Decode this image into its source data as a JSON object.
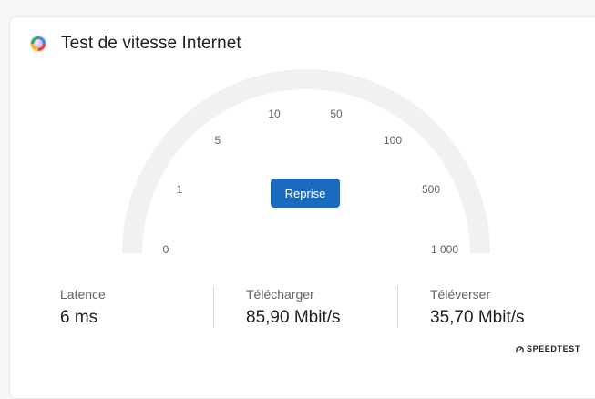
{
  "header": {
    "title": "Test de vitesse Internet",
    "logo_icon": "google-assistant-logo"
  },
  "gauge": {
    "ticks": [
      "0",
      "1",
      "5",
      "10",
      "50",
      "100",
      "500",
      "1 000"
    ],
    "track_color": "#f1f1f1"
  },
  "actions": {
    "restart_label": "Reprise",
    "restart_color": "#1a6bbf"
  },
  "stats": {
    "latency": {
      "label": "Latence",
      "value": "6 ms"
    },
    "download": {
      "label": "Télécharger",
      "value": "85,90 Mbit/s"
    },
    "upload": {
      "label": "Téléverser",
      "value": "35,70 Mbit/s"
    }
  },
  "branding": {
    "provider": "SPEEDTEST",
    "provider_icon": "speedometer-icon"
  }
}
